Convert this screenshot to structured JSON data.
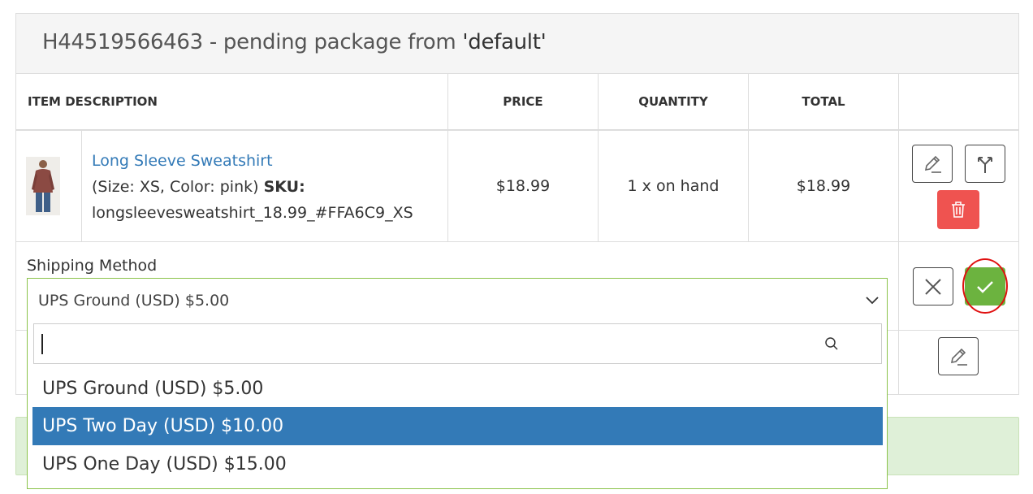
{
  "package": {
    "title_prefix": "H44519566463 - pending package from ",
    "title_source": "'default'"
  },
  "table": {
    "headers": {
      "description": "ITEM DESCRIPTION",
      "price": "PRICE",
      "quantity": "QUANTITY",
      "total": "TOTAL"
    },
    "item": {
      "name": "Long Sleeve Sweatshirt",
      "options": "(Size: XS, Color: pink) ",
      "sku_label": "SKU:",
      "sku": "longsleevesweatshirt_18.99_#FFA6C9_XS",
      "price": "$18.99",
      "quantity": "1 x on hand",
      "total": "$18.99"
    }
  },
  "shipping": {
    "label": "Shipping Method",
    "selected": "UPS Ground (USD) $5.00",
    "search_value": "",
    "options": [
      {
        "label": "UPS Ground (USD) $5.00",
        "highlighted": false
      },
      {
        "label": "UPS Two Day (USD) $10.00",
        "highlighted": true
      },
      {
        "label": "UPS One Day (USD) $15.00",
        "highlighted": false
      }
    ]
  },
  "icons": {
    "edit": "pencil-icon",
    "split": "split-arrow-icon",
    "delete": "trash-icon",
    "cancel": "close-icon",
    "confirm": "check-icon",
    "search": "search-icon",
    "chevron": "chevron-down-icon"
  },
  "colors": {
    "link": "#337ab7",
    "danger": "#ef5350",
    "success": "#6cb33f",
    "highlight": "#337ab7",
    "focus_border": "#8bc34a",
    "alert_bg": "#dff0d8",
    "annotation": "#e01010"
  }
}
